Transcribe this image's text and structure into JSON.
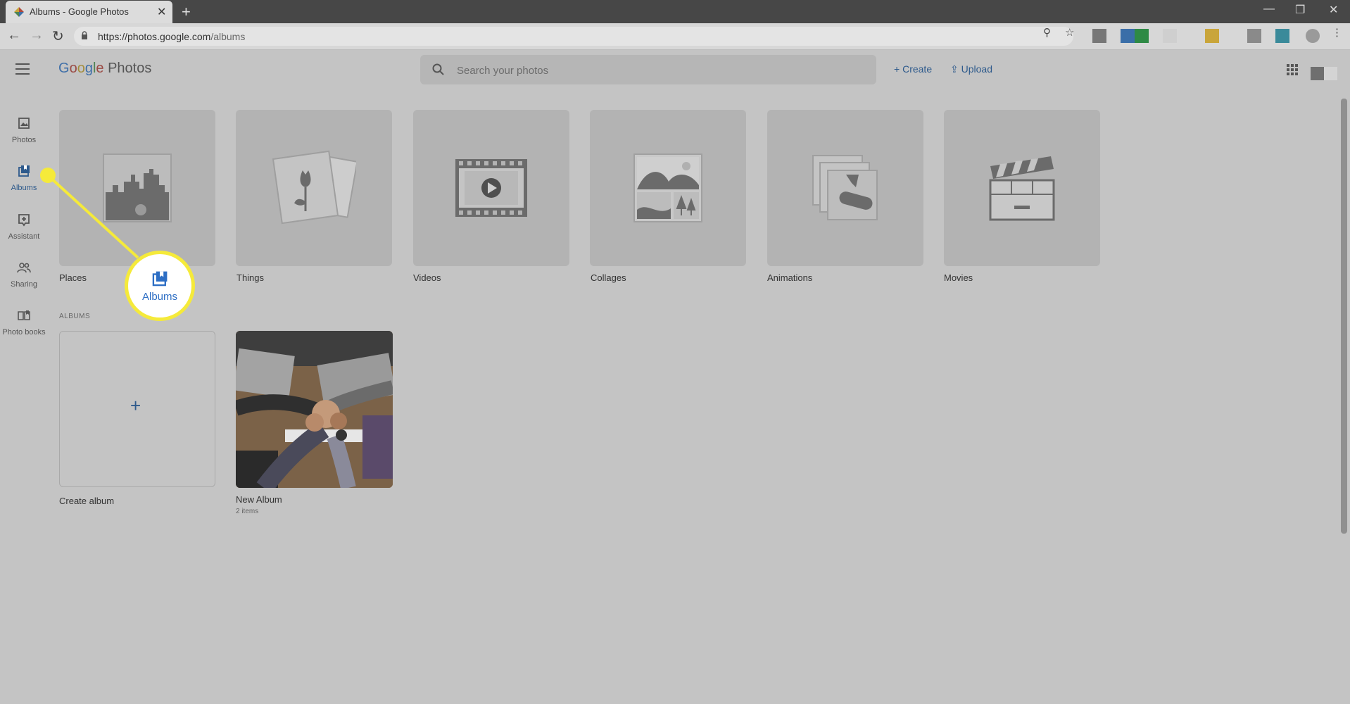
{
  "browser": {
    "tab_title": "Albums - Google Photos",
    "tab_close": "✕",
    "new_tab": "+",
    "url_host": "https://photos.google.com",
    "url_path": "/albums",
    "window_controls": [
      "—",
      "❐",
      "✕"
    ]
  },
  "app": {
    "logo_google": [
      "G",
      "o",
      "o",
      "g",
      "l",
      "e"
    ],
    "logo_product": "Photos",
    "search_placeholder": "Search your photos",
    "create_label": "Create",
    "upload_label": "Upload",
    "accent": "#1a73e8"
  },
  "rail": [
    {
      "label": "Photos",
      "icon": "photo-icon",
      "active": false
    },
    {
      "label": "Albums",
      "icon": "album-icon",
      "active": true
    },
    {
      "label": "Assistant",
      "icon": "assistant-icon",
      "active": false
    },
    {
      "label": "Sharing",
      "icon": "people-icon",
      "active": false
    },
    {
      "label": "Photo books",
      "icon": "book-icon",
      "active": false
    }
  ],
  "categories": [
    {
      "label": "Places",
      "icon": "city-icon"
    },
    {
      "label": "Things",
      "icon": "flower-photo-icon"
    },
    {
      "label": "Videos",
      "icon": "film-play-icon"
    },
    {
      "label": "Collages",
      "icon": "collage-icon"
    },
    {
      "label": "Animations",
      "icon": "stacked-frames-icon"
    },
    {
      "label": "Movies",
      "icon": "clapperboard-icon"
    }
  ],
  "albums_section": {
    "heading": "ALBUMS",
    "create_plus": "+",
    "create_label": "Create album",
    "albums": [
      {
        "title": "New Album",
        "count": "2 items"
      }
    ]
  },
  "callout": {
    "label": "Albums",
    "color": "#f5ea3a"
  }
}
